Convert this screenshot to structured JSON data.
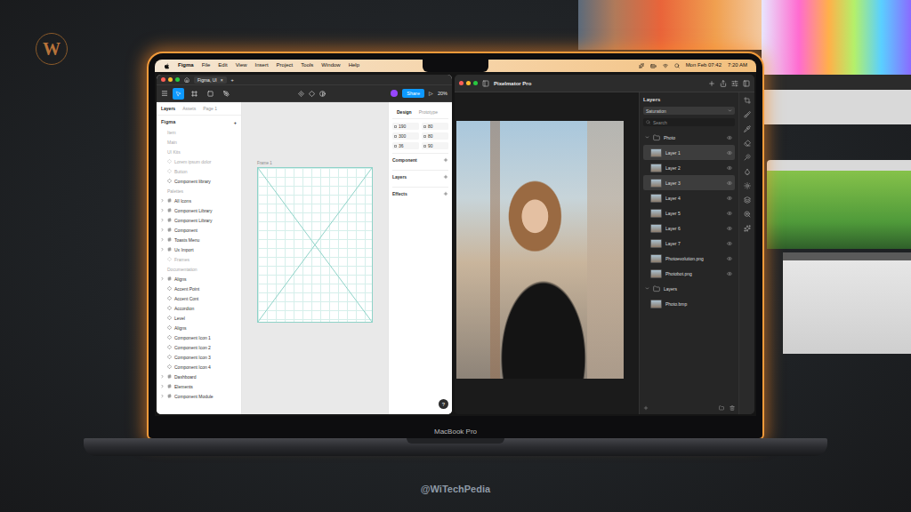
{
  "brand": {
    "logo": "W",
    "watermark": "@WiTechPedia"
  },
  "laptop": {
    "label": "MacBook Pro"
  },
  "menu_bar": {
    "app": "Figma",
    "items": [
      "File",
      "Edit",
      "View",
      "Insert",
      "Project",
      "Tools",
      "Window",
      "Help"
    ],
    "date": "Mon Feb 07:42",
    "time": "7:20 AM"
  },
  "figma": {
    "tab": {
      "label": "Figma, UI",
      "close": "×"
    },
    "new_tab": "+",
    "tools": [
      {
        "kind": "move",
        "selected": true
      },
      {
        "kind": "frame",
        "selected": false
      },
      {
        "kind": "shape",
        "selected": false
      },
      {
        "kind": "pen",
        "selected": false
      }
    ],
    "share": "Share",
    "play": "▷",
    "zoom": "20%",
    "panel_tabs": [
      {
        "label": "Layers",
        "selected": true
      },
      {
        "label": "Assets",
        "selected": false
      },
      {
        "label": "Page 1",
        "selected": false
      }
    ],
    "add": "+",
    "layers": [
      {
        "label": "Figma",
        "kind": "header",
        "muted": false
      },
      {
        "label": "Item",
        "kind": "page",
        "muted": true
      },
      {
        "label": "Main",
        "kind": "page",
        "muted": true
      },
      {
        "label": "UI Kits",
        "kind": "page",
        "muted": true
      },
      {
        "label": "Lorem ipsum dolor",
        "kind": "layer",
        "muted": true
      },
      {
        "label": "Button",
        "kind": "layer",
        "muted": true
      },
      {
        "label": "Component library",
        "kind": "layer",
        "muted": false
      },
      {
        "label": "Palettes",
        "kind": "page",
        "muted": true
      },
      {
        "label": "All Icons",
        "kind": "group",
        "muted": false
      },
      {
        "label": "Component Library",
        "kind": "group",
        "muted": false
      },
      {
        "label": "Component Library",
        "kind": "group",
        "muted": false
      },
      {
        "label": "Component",
        "kind": "group",
        "muted": false
      },
      {
        "label": "Toasts Menu",
        "kind": "group",
        "muted": false
      },
      {
        "label": "Ux Import",
        "kind": "group",
        "muted": false
      },
      {
        "label": "Frames",
        "kind": "layer",
        "muted": true
      },
      {
        "label": "Documentation",
        "kind": "page",
        "muted": true
      },
      {
        "label": "Aligns",
        "kind": "group",
        "muted": false
      },
      {
        "label": "Accent Point",
        "kind": "layer",
        "muted": false
      },
      {
        "label": "Accent Cont",
        "kind": "layer",
        "muted": false
      },
      {
        "label": "Accordion",
        "kind": "layer",
        "muted": false
      },
      {
        "label": "Level",
        "kind": "layer",
        "muted": false
      },
      {
        "label": "Aligns",
        "kind": "layer",
        "muted": false
      },
      {
        "label": "Component Icon 1",
        "kind": "layer",
        "muted": false
      },
      {
        "label": "Component Icon 2",
        "kind": "layer",
        "muted": false
      },
      {
        "label": "Component Icon 3",
        "kind": "layer",
        "muted": false
      },
      {
        "label": "Component Icon 4",
        "kind": "layer",
        "muted": false
      },
      {
        "label": "Dashboard",
        "kind": "group",
        "muted": false
      },
      {
        "label": "Elements",
        "kind": "group",
        "muted": false
      },
      {
        "label": "Component Module",
        "kind": "group",
        "muted": false
      }
    ],
    "frame_label": "Frame 1",
    "design_tabs": [
      {
        "label": "Design",
        "selected": true
      },
      {
        "label": "Prototype",
        "selected": false
      }
    ],
    "fields": [
      {
        "value": "190"
      },
      {
        "value": "80"
      },
      {
        "value": "300"
      },
      {
        "value": "80"
      },
      {
        "value": "36"
      },
      {
        "value": "90"
      }
    ],
    "sections": [
      "Component",
      "Layers",
      "Effects"
    ],
    "help": "?"
  },
  "pixelmator": {
    "title": "Pixelmator Pro",
    "panel_title": "Layers",
    "blend": "Saturation",
    "search": {
      "placeholder": "Search"
    },
    "layers": [
      {
        "label": "Photo",
        "kind": "group",
        "selected": false,
        "visible": true
      },
      {
        "label": "Layer 1",
        "kind": "layer",
        "selected": true,
        "visible": true
      },
      {
        "label": "Layer 2",
        "kind": "layer",
        "selected": false,
        "visible": true
      },
      {
        "label": "Layer 3",
        "kind": "layer",
        "selected": true,
        "visible": true
      },
      {
        "label": "Layer 4",
        "kind": "layer",
        "selected": false,
        "visible": true
      },
      {
        "label": "Layer 5",
        "kind": "layer",
        "selected": false,
        "visible": true
      },
      {
        "label": "Layer 6",
        "kind": "layer",
        "selected": false,
        "visible": true
      },
      {
        "label": "Layer 7",
        "kind": "layer",
        "selected": false,
        "visible": true
      },
      {
        "label": "Photoevolution.png",
        "kind": "layer",
        "selected": false,
        "visible": true
      },
      {
        "label": "Photobot.png",
        "kind": "layer",
        "selected": false,
        "visible": true
      },
      {
        "label": "Layers",
        "kind": "group",
        "selected": false,
        "visible": false
      },
      {
        "label": "Photo.bmp",
        "kind": "layer",
        "selected": false,
        "visible": false
      }
    ]
  }
}
